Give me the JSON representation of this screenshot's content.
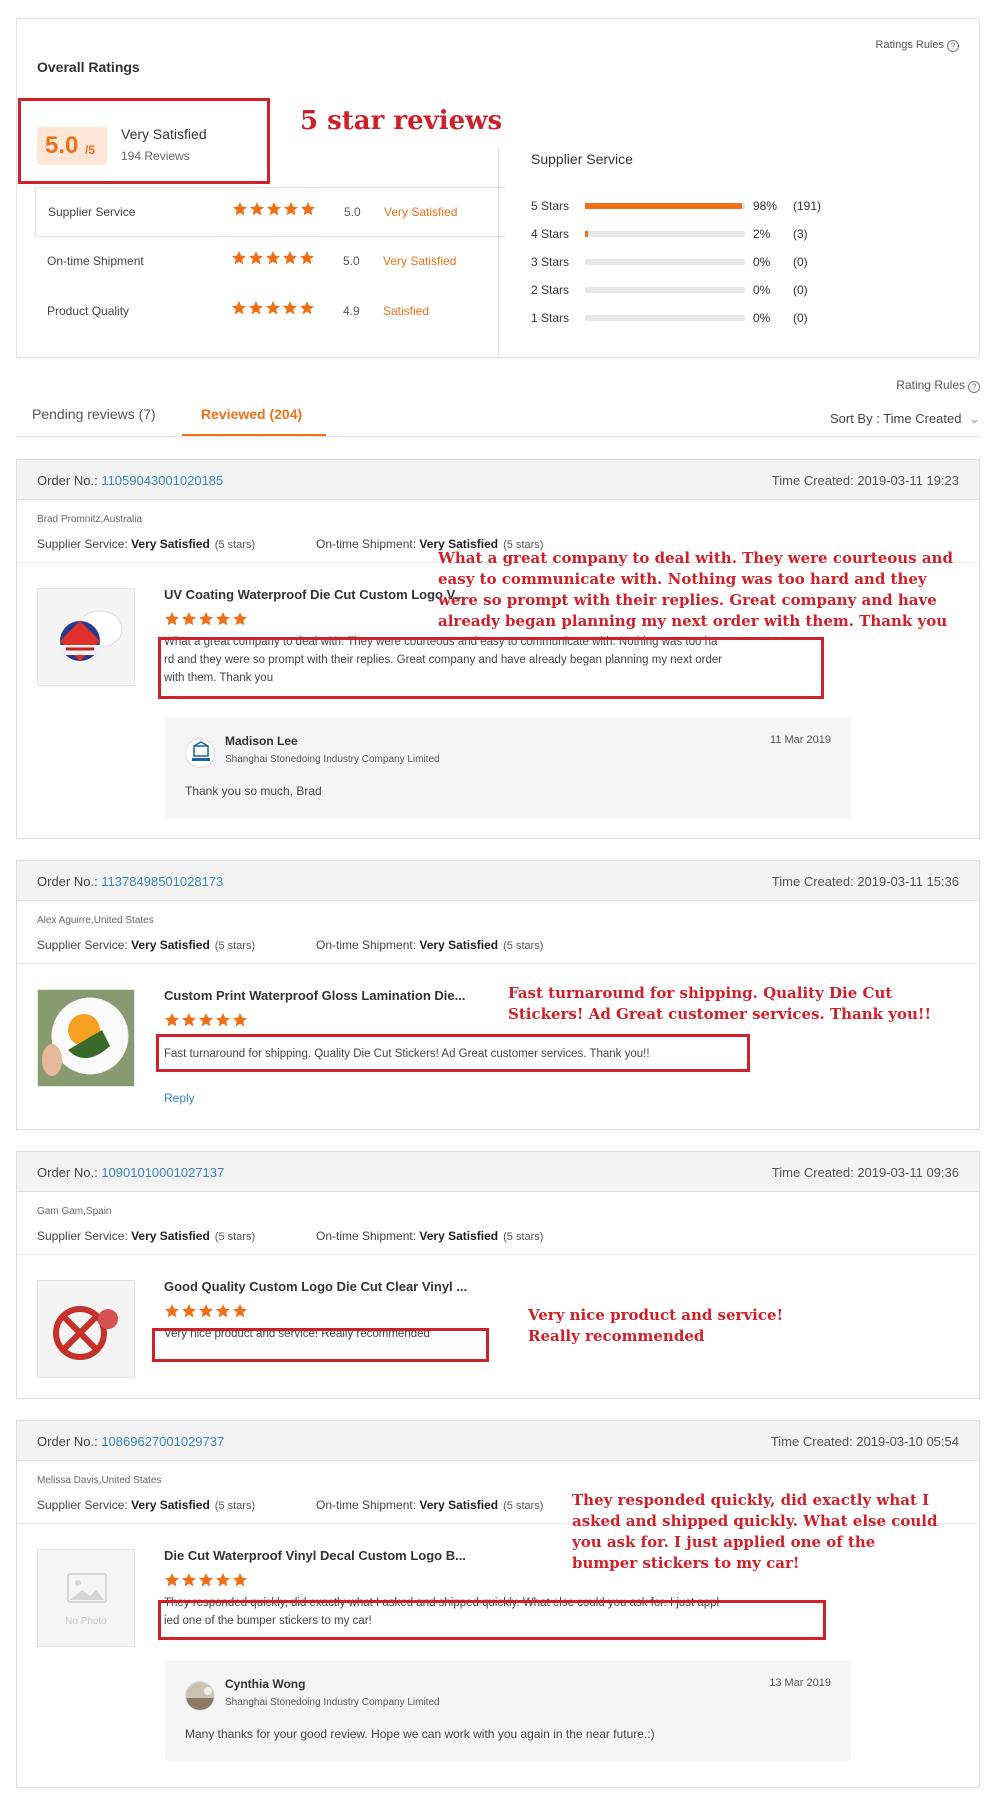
{
  "overall": {
    "title": "Overall Ratings",
    "ratings_rules": "Ratings Rules",
    "score": "5.0",
    "score_suffix": "/5",
    "level": "Very Satisfied",
    "reviews_count": "194 Reviews",
    "annotation": "5 star reviews",
    "sub_ratings": [
      {
        "label": "Supplier Service",
        "stars": 5,
        "value": "5.0",
        "level": "Very Satisfied"
      },
      {
        "label": "On-time Shipment",
        "stars": 5,
        "value": "5.0",
        "level": "Very Satisfied"
      },
      {
        "label": "Product Quality",
        "stars": 5,
        "value": "4.9",
        "level": "Satisfied"
      }
    ],
    "supplier_service": {
      "title": "Supplier Service",
      "rows": [
        {
          "label": "5 Stars",
          "fraction": 0.98,
          "pct": "98%",
          "count": "(191)"
        },
        {
          "label": "4 Stars",
          "fraction": 0.02,
          "pct": "2%",
          "count": "(3)"
        },
        {
          "label": "3 Stars",
          "fraction": 0,
          "pct": "0%",
          "count": "(0)"
        },
        {
          "label": "2 Stars",
          "fraction": 0,
          "pct": "0%",
          "count": "(0)"
        },
        {
          "label": "1 Stars",
          "fraction": 0,
          "pct": "0%",
          "count": "(0)"
        }
      ]
    }
  },
  "tabs": {
    "rating_rules": "Rating Rules",
    "pending": "Pending reviews (7)",
    "reviewed": "Reviewed (204)",
    "sort_by": "Sort By : Time Created"
  },
  "labels": {
    "order_no": "Order No.:",
    "time_created": "Time Created:",
    "supplier_service": "Supplier Service:",
    "ontime_shipment": "On-time Shipment:",
    "very_satisfied": "Very Satisfied",
    "five_stars": "(5 stars)",
    "reply": "Reply",
    "no_photo": "No Photo"
  },
  "reviews": [
    {
      "order_no": "11059043001020185",
      "time": "2019-03-11 19:23",
      "buyer": "Brad Promnitz,Australia",
      "product": "UV Coating Waterproof Die Cut Custom Logo V...",
      "text_lines": [
        "What a great company to deal with. They were courteous and easy to communicate with. Nothing was too ha",
        "rd and they were so prompt with their replies. Great company and have already began planning my next order",
        "with them. Thank you"
      ],
      "annotation": [
        "What a great company to deal with. They were courteous and",
        "easy to communicate with. Nothing was too hard and they",
        "were so prompt with their replies. Great company and have",
        "already began planning my next order with them. Thank you"
      ],
      "reply": {
        "name": "Madison Lee",
        "company": "Shanghai Stonedoing Industry Company Limited",
        "date": "11 Mar 2019",
        "message": "Thank you so much, Brad"
      }
    },
    {
      "order_no": "11378498501028173",
      "time": "2019-03-11 15:36",
      "buyer": "Alex Aguirre,United States",
      "product": "Custom Print Waterproof Gloss Lamination Die...",
      "text_lines": [
        "Fast turnaround for shipping. Quality Die Cut Stickers! Ad Great customer services. Thank you!!"
      ],
      "annotation": [
        "Fast turnaround for shipping. Quality Die Cut",
        "Stickers! Ad Great customer services. Thank you!!"
      ]
    },
    {
      "order_no": "10901010001027137",
      "time": "2019-03-11 09:36",
      "buyer": "Gam Gam,Spain",
      "product": "Good Quality Custom Logo Die Cut Clear Vinyl ...",
      "text_lines": [
        "Very nice product and service! Really recommended"
      ],
      "annotation": [
        "Very nice product and service!",
        "Really recommended"
      ]
    },
    {
      "order_no": "10869627001029737",
      "time": "2019-03-10 05:54",
      "buyer": "Melissa Davis,United States",
      "product": "Die Cut Waterproof Vinyl Decal Custom Logo B...",
      "text_lines": [
        "They responded quickly, did exactly what I asked and shipped quickly. What else could you ask for. I just appl",
        "ied one of the bumper stickers to my car!"
      ],
      "annotation": [
        "They responded quickly, did exactly what I",
        "asked and shipped quickly. What else could",
        "you ask for.    I just applied one of the",
        "bumper stickers to my car!"
      ],
      "reply": {
        "name": "Cynthia Wong",
        "company": "Shanghai Stonedoing Industry Company Limited",
        "date": "13 Mar 2019",
        "message": "Many thanks for your good review. Hope we can work with you again in the near future.:)"
      }
    }
  ],
  "colors": {
    "accent": "#f07018",
    "link": "#3a84c8",
    "annotation": "#d0202a"
  }
}
